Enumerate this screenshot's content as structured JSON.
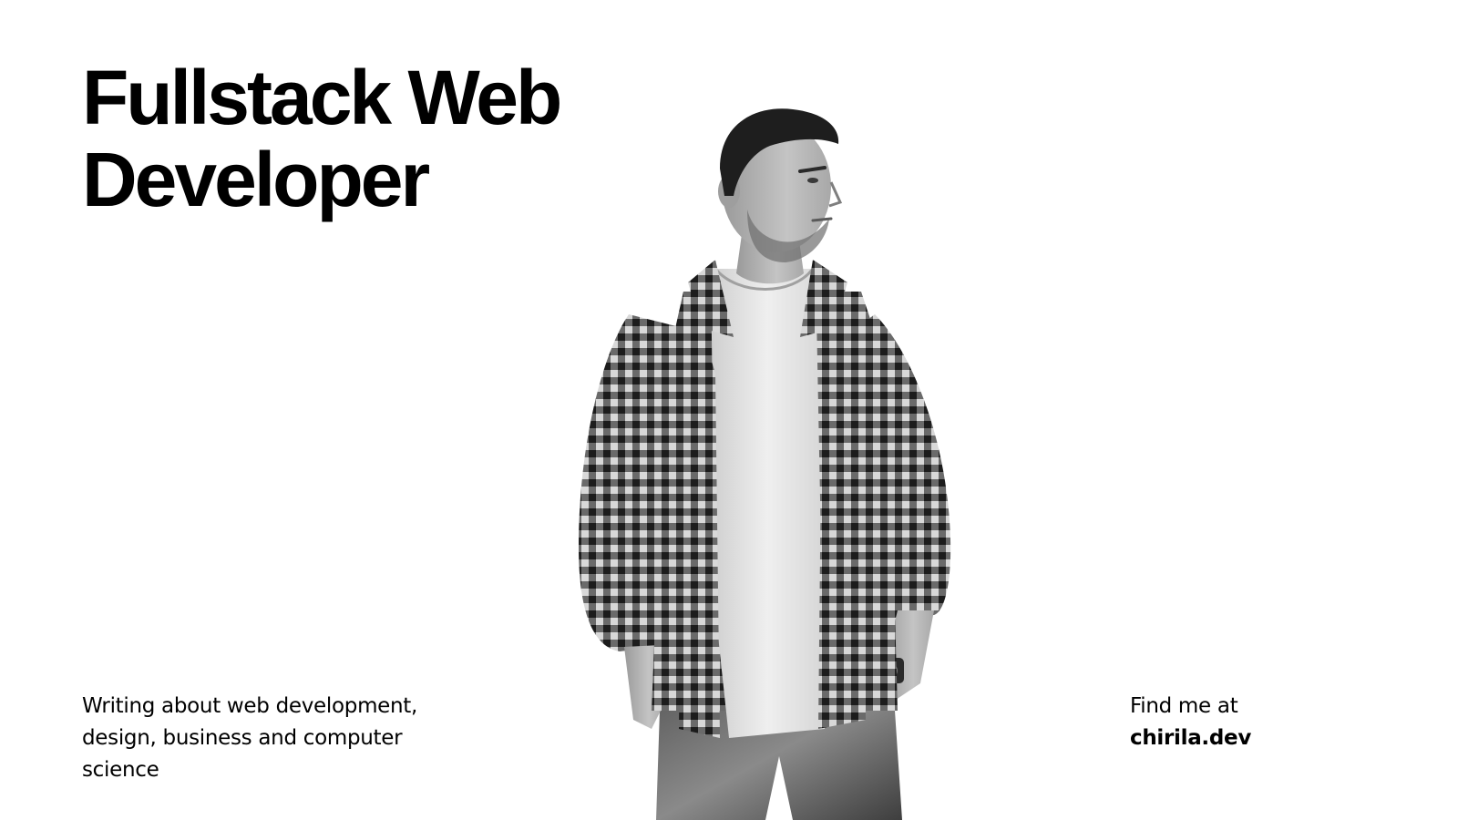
{
  "hero": {
    "headline_line1": "Fullstack Web",
    "headline_line2": "Developer"
  },
  "tagline": {
    "text": "Writing about web development, design, business and computer science"
  },
  "contact": {
    "prefix": "Find me at",
    "domain": "chirila.dev"
  },
  "portrait": {
    "icon": "person-portrait-icon",
    "style": "black and white photo, checkered flannel shirt over white t-shirt, jeans, wristwatch"
  },
  "colors": {
    "background": "#ffffff",
    "text": "#000000"
  }
}
